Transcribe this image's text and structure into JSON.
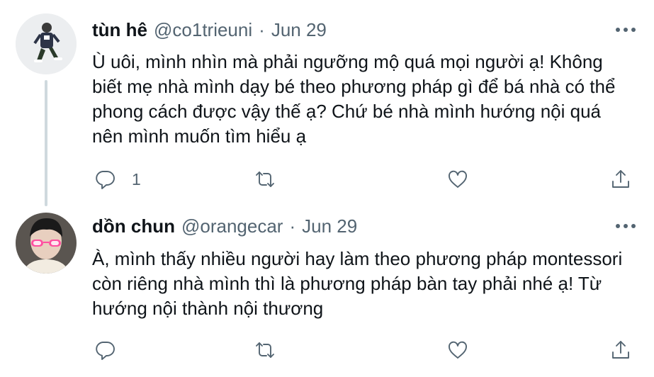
{
  "tweets": [
    {
      "display_name": "tùn hê",
      "handle": "@co1trieuni",
      "separator": "·",
      "date": "Jun 29",
      "text": "Ù uôi, mình nhìn mà phải ngưỡng mộ quá mọi người ạ! Không\nbiết mẹ nhà mình dạy bé theo phương pháp gì để bá nhà có thể\nphong cách được vậy thế ạ? Chứ bé nhà mình hướng nội quá\nnên mình muốn tìm hiểu ạ",
      "reply_count": "1"
    },
    {
      "display_name": "dồn chun",
      "handle": "@orangecar",
      "separator": "·",
      "date": "Jun 29",
      "text": "À, mình thấy nhiều người hay làm theo phương pháp montessori\ncòn riêng nhà mình thì là phương pháp bàn tay phải nhé ạ! Từ\nhướng nội thành nội thương",
      "reply_count": ""
    }
  ],
  "icons": {
    "reply": "reply-icon",
    "retweet": "retweet-icon",
    "like": "heart-icon",
    "share": "share-icon",
    "more": "more-icon"
  },
  "colors": {
    "text": "#0f1419",
    "secondary": "#536471",
    "thread_line": "#cfd9de",
    "background": "#ffffff"
  }
}
